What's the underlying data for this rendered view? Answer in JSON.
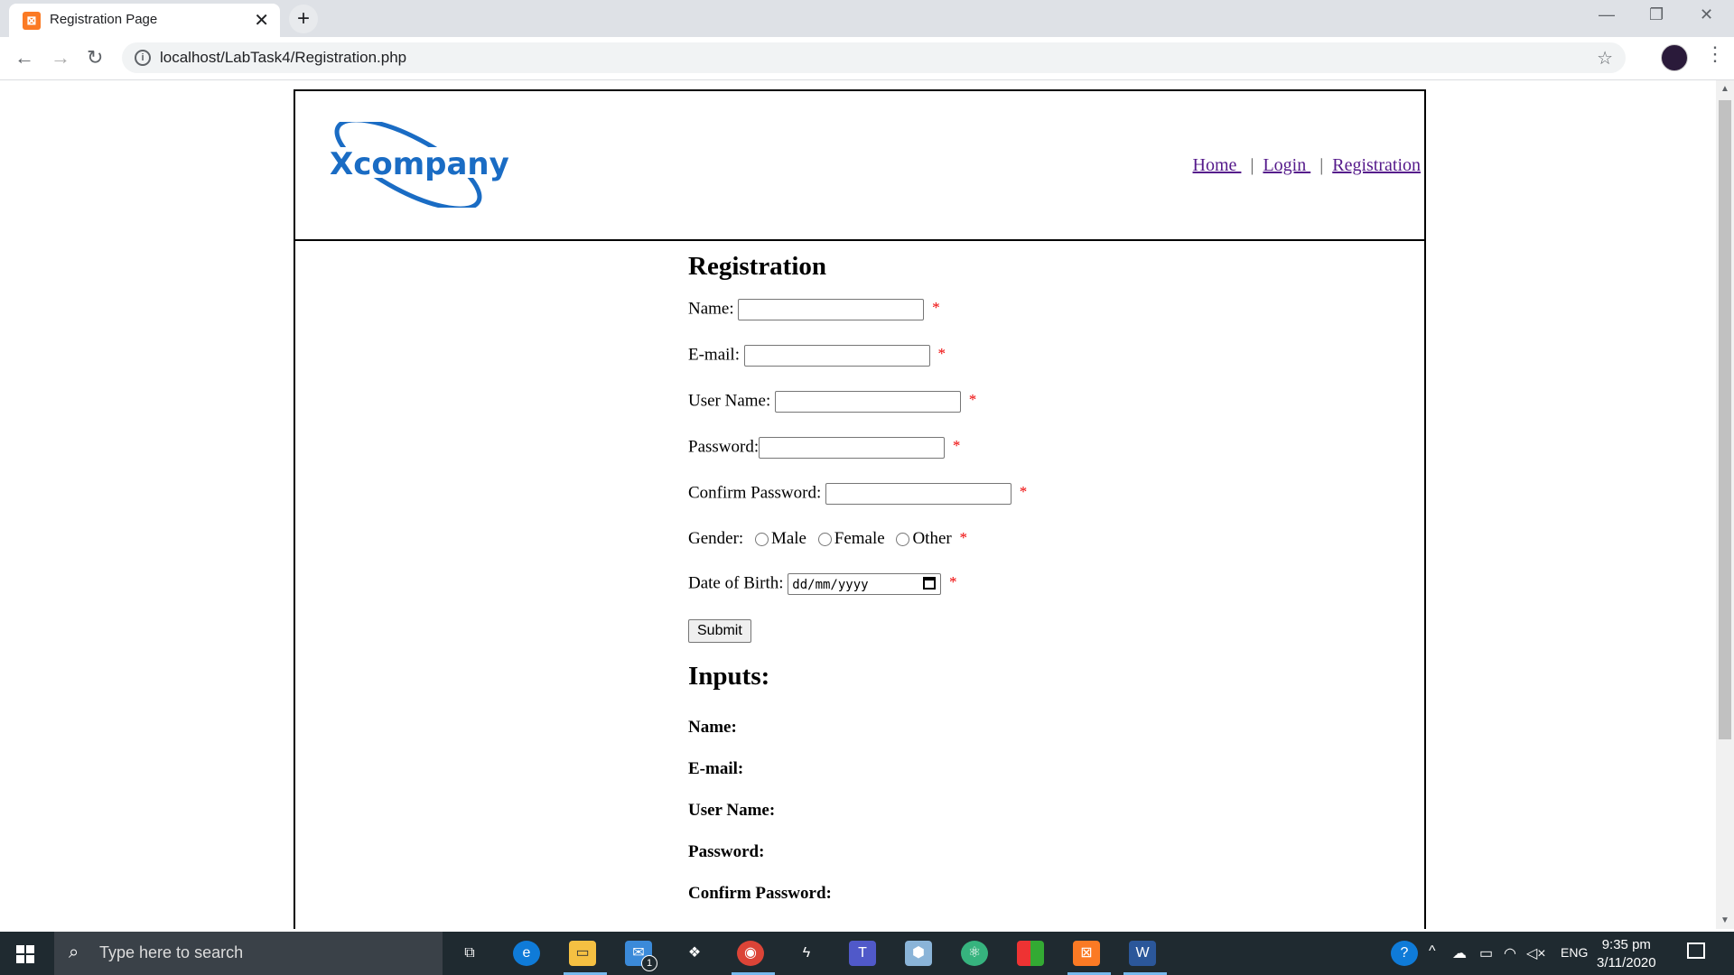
{
  "browser": {
    "tab_title": "Registration Page",
    "tab_favicon": "xampp-icon",
    "url": "localhost/LabTask4/Registration.php"
  },
  "site": {
    "logo_text": "Xcompany",
    "nav": [
      {
        "label": "Home "
      },
      {
        "label": "Login "
      },
      {
        "label": "Registration"
      }
    ],
    "nav_separator": "|"
  },
  "form": {
    "title": "Registration",
    "name_label": "Name:",
    "email_label": "E-mail:",
    "username_label": "User Name:",
    "password_label": "Password:",
    "confirm_label": "Confirm Password:",
    "gender_label": "Gender:",
    "gender_options": [
      "Male",
      "Female",
      "Other"
    ],
    "dob_label": "Date of Birth:",
    "dob_placeholder": "dd/mm/yyyy",
    "required_mark": "*",
    "submit_label": "Submit"
  },
  "inputs_section": {
    "title": "Inputs:",
    "fields": [
      "Name:",
      "E-mail:",
      "User Name:",
      "Password:",
      "Confirm Password:"
    ]
  },
  "taskbar": {
    "search_placeholder": "Type here to search",
    "language": "ENG",
    "time": "9:35 pm",
    "date": "3/11/2020",
    "mail_badge": "1"
  },
  "colors": {
    "link": "#551a8b",
    "required": "#ee0000",
    "logo_blue": "#1a6cc4"
  }
}
